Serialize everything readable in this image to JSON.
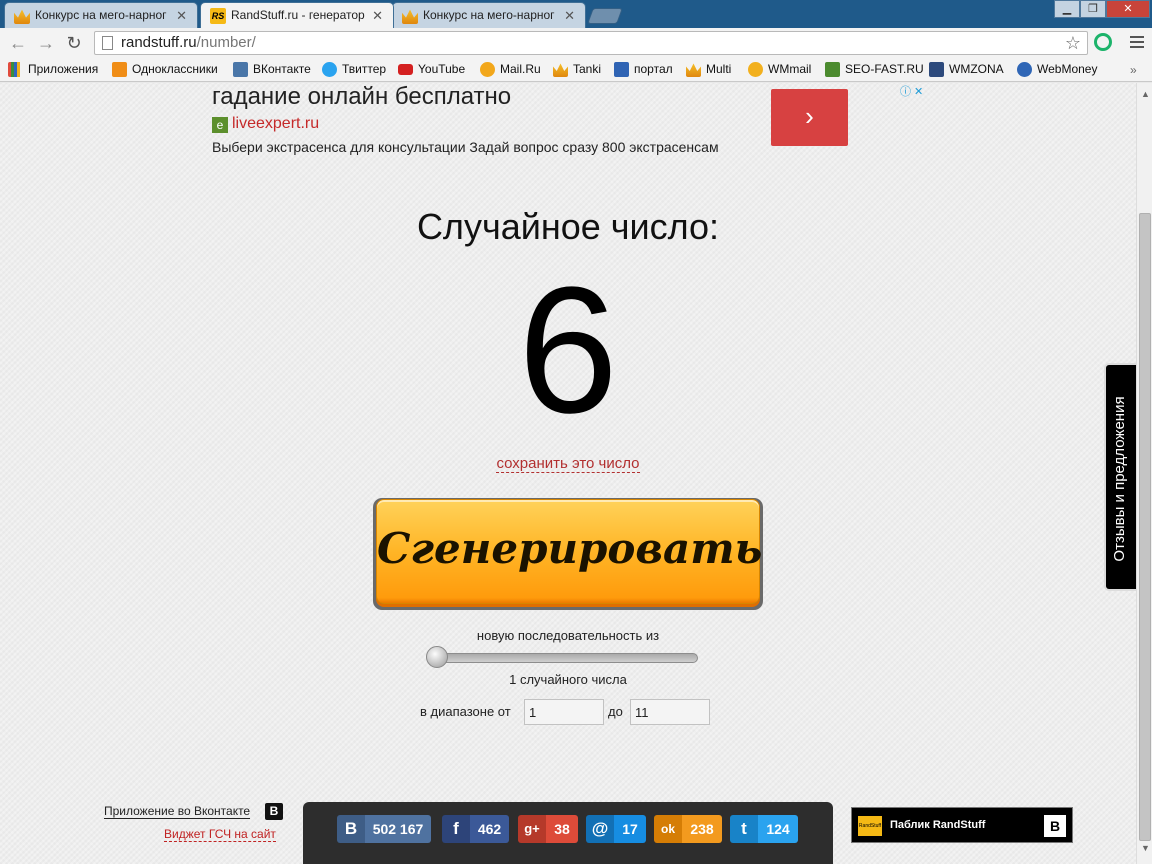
{
  "tabs": [
    {
      "title": "Конкурс на мего-нарног",
      "icon": "crown-icon",
      "active": false
    },
    {
      "title": "RandStuff.ru - генератор",
      "icon": "randstuff-favicon",
      "active": true
    },
    {
      "title": "Конкурс на мего-нарног",
      "icon": "crown-icon",
      "active": false
    }
  ],
  "address": {
    "host": "randstuff.ru",
    "path": "/number/"
  },
  "bookmarks": [
    {
      "label": "Приложения",
      "icon": "apps-grid-icon",
      "color": "#e14a3c"
    },
    {
      "label": "Одноклассники",
      "icon": "odnoklassniki-icon",
      "color": "#f08d16"
    },
    {
      "label": "ВКонтакте",
      "icon": "vk-icon",
      "color": "#4a76a8"
    },
    {
      "label": "Твиттер",
      "icon": "twitter-icon",
      "color": "#2aa3ef"
    },
    {
      "label": "YouTube",
      "icon": "youtube-icon",
      "color": "#d42020"
    },
    {
      "label": "Mail.Ru",
      "icon": "mailru-icon",
      "color": "#168de2"
    },
    {
      "label": "Tanki",
      "icon": "crown-icon",
      "color": "#e89b16"
    },
    {
      "label": "портал",
      "icon": "idc-icon",
      "color": "#2f64b4"
    },
    {
      "label": "Multi",
      "icon": "crown-icon",
      "color": "#e89b16"
    },
    {
      "label": "WMmail",
      "icon": "wmmail-icon",
      "color": "#f2b01e"
    },
    {
      "label": "SEO-FAST.RU",
      "icon": "seofast-icon",
      "color": "#4c8b2f"
    },
    {
      "label": "WMZONA",
      "icon": "wmzona-icon",
      "color": "#2d4a7c"
    },
    {
      "label": "WebMoney",
      "icon": "webmoney-icon",
      "color": "#2f66b6"
    }
  ],
  "ad": {
    "title": "гадание онлайн бесплатно",
    "site": "liveexpert.ru",
    "description": "Выбери экстрасенса для консультации Задай вопрос сразу 800 экстрасенсам",
    "go": "›",
    "badges": "ⓘ ✕"
  },
  "main": {
    "title": "Случайное число:",
    "number": "6",
    "save_link": "сохранить это число",
    "generate_button": "Сгенерировать",
    "sequence_label": "новую последовательность из",
    "count_label": "1 случайного числа",
    "count_value": 1,
    "range_from_label": "в диапазоне от",
    "range_to_label": "до",
    "range_from": "1",
    "range_to": "11"
  },
  "feedback_tab": "Отзывы и предложения",
  "footer": {
    "vk_app_link": "Приложение во Вконтакте",
    "widget_link": "Виджет ГСЧ на сайт",
    "public_label": "Паблик RandStuff",
    "public_logo": "RandStuff",
    "vk_letter": "B",
    "shares": [
      {
        "network": "vk",
        "icon": "vk-icon",
        "glyph": "B",
        "count": "502 167",
        "color": "#4f72a0",
        "dark": "#3e5d86"
      },
      {
        "network": "facebook",
        "icon": "facebook-icon",
        "glyph": "f",
        "count": "462",
        "color": "#3b5998",
        "dark": "#2d4479"
      },
      {
        "network": "googleplus",
        "icon": "googleplus-icon",
        "glyph": "g+",
        "count": "38",
        "color": "#dd4b39",
        "dark": "#b5392a"
      },
      {
        "network": "mailru",
        "icon": "mailru-icon",
        "glyph": "@",
        "count": "17",
        "color": "#168de2",
        "dark": "#1270b5"
      },
      {
        "network": "odnoklassniki",
        "icon": "odnoklassniki-icon",
        "glyph": "ok",
        "count": "238",
        "color": "#f39a1e",
        "dark": "#d57d05"
      },
      {
        "network": "twitter",
        "icon": "twitter-icon",
        "glyph": "t",
        "count": "124",
        "color": "#2aa3ef",
        "dark": "#1883c8"
      }
    ]
  }
}
